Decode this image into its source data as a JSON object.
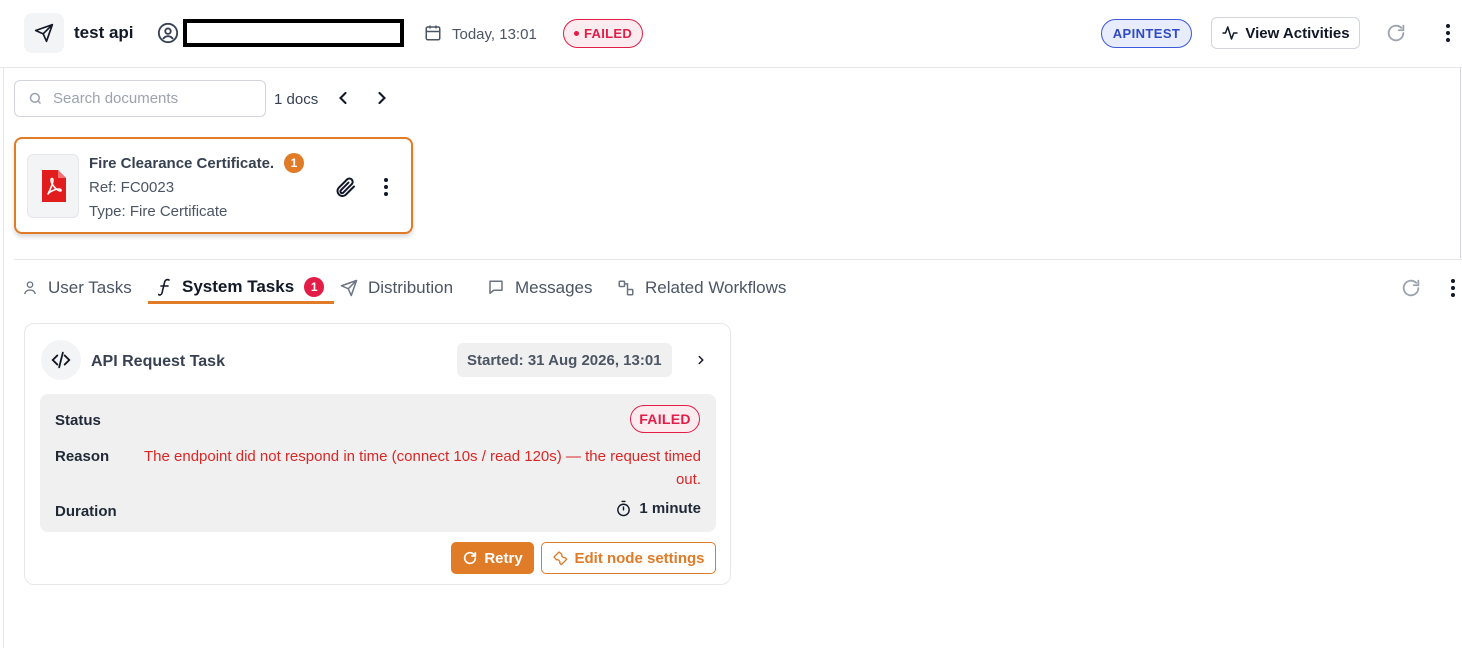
{
  "header": {
    "title": "test api",
    "date": "Today, 13:01",
    "status_badge": "FAILED",
    "tag": "APINTEST",
    "view_activities_label": "View Activities"
  },
  "documents": {
    "search_placeholder": "Search documents",
    "count_label": "1 docs",
    "items": [
      {
        "name": "Fire Clearance Certificate.",
        "badge": "1",
        "ref": "Ref: FC0023",
        "type": "Type: Fire Certificate"
      }
    ]
  },
  "tabs": [
    {
      "label": "User Tasks",
      "icon": "user-icon"
    },
    {
      "label": "System Tasks",
      "icon": "function-icon",
      "badge": "1",
      "active": true
    },
    {
      "label": "Distribution",
      "icon": "send-icon"
    },
    {
      "label": "Messages",
      "icon": "message-icon"
    },
    {
      "label": "Related Workflows",
      "icon": "workflow-icon"
    }
  ],
  "task": {
    "title": "API Request Task",
    "started": "Started: 31 Aug 2026, 13:01",
    "status_label": "Status",
    "status_value": "FAILED",
    "reason_label": "Reason",
    "reason_value": "The endpoint did not respond in time (connect 10s / read 120s) — the request timed out.",
    "duration_label": "Duration",
    "duration_value": "1 minute",
    "retry_label": "Retry",
    "edit_label": "Edit node settings"
  },
  "colors": {
    "accent": "#e07b28",
    "danger": "#e11d48",
    "tag_blue": "#2f4ac5"
  }
}
